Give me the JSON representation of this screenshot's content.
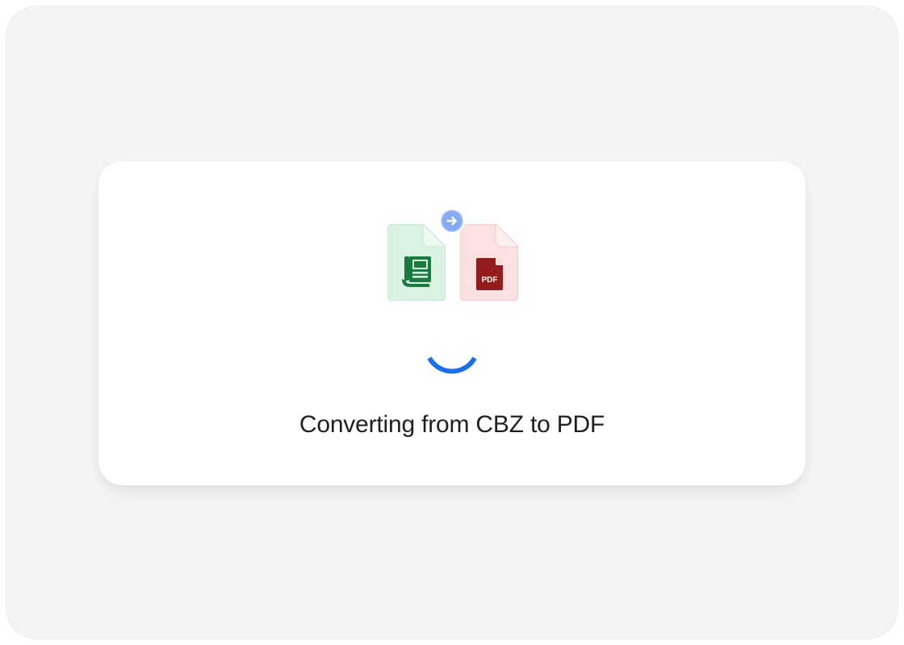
{
  "conversion": {
    "source_format": "CBZ",
    "target_format": "PDF",
    "status_text": "Converting from CBZ to PDF",
    "target_icon_label": "PDF"
  },
  "icons": {
    "source": "comic-book-file-icon",
    "target": "pdf-file-icon",
    "direction": "arrow-right-icon",
    "loader": "loading-spinner-icon"
  },
  "colors": {
    "source_bg": "#daf2e2",
    "source_icon": "#177a3e",
    "target_bg": "#fbe1e1",
    "target_icon": "#931c1c",
    "arrow_badge": "#86abf5",
    "spinner": "#1a6fef"
  }
}
